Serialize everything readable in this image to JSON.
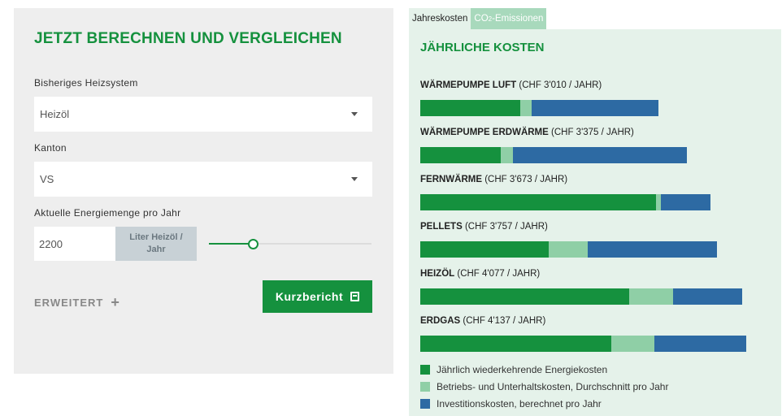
{
  "calculator": {
    "title": "JETZT BERECHNEN UND VERGLEICHEN",
    "heating_label": "Bisheriges Heizsystem",
    "heating_value": "Heizöl",
    "canton_label": "Kanton",
    "canton_value": "VS",
    "energy_label": "Aktuelle Energiemenge pro Jahr",
    "energy_value": "2200",
    "unit_line1": "Liter Heizöl /",
    "unit_line2": "Jahr",
    "slider_fraction": 0.27,
    "advanced_label": "ERWEITERT",
    "advanced_icon": "plus-icon",
    "report_button": "Kurzbericht",
    "report_icon": "document-icon"
  },
  "tabs": [
    {
      "label": "Jahreskosten",
      "active": true
    },
    {
      "label_prefix": "CO",
      "label_sub": "2",
      "label_suffix": "-Emissionen",
      "active": false
    }
  ],
  "results": {
    "title": "JÄHRLICHE KOSTEN",
    "systems": [
      {
        "name": "WÄRMEPUMPE LUFT",
        "cost": "(CHF 3'010 / JAHR)",
        "energy": 0.279,
        "maintenance": 0.033,
        "investment": 0.353
      },
      {
        "name": "WÄRMEPUMPE ERDWÄRME",
        "cost": "(CHF 3'375 / JAHR)",
        "energy": 0.226,
        "maintenance": 0.033,
        "investment": 0.486
      },
      {
        "name": "FERNWÄRME",
        "cost": "(CHF 3'673 / JAHR)",
        "energy": 0.66,
        "maintenance": 0.012,
        "investment": 0.139
      },
      {
        "name": "PELLETS",
        "cost": "(CHF 3'757 / JAHR)",
        "energy": 0.359,
        "maintenance": 0.11,
        "investment": 0.36
      },
      {
        "name": "HEIZÖL",
        "cost": "(CHF 4'077 / JAHR)",
        "energy": 0.585,
        "maintenance": 0.122,
        "investment": 0.192
      },
      {
        "name": "ERDGAS",
        "cost": "(CHF 4'137 / JAHR)",
        "energy": 0.533,
        "maintenance": 0.122,
        "investment": 0.257
      }
    ],
    "legend": [
      {
        "label": "Jährlich wiederkehrende Energiekosten",
        "color": "#15913e"
      },
      {
        "label": "Betriebs- und Unterhaltskosten, Durchschnitt pro Jahr",
        "color": "#8fcfa6"
      },
      {
        "label": "Investitionskosten, berechnet pro Jahr",
        "color": "#2d6aa3"
      }
    ]
  }
}
